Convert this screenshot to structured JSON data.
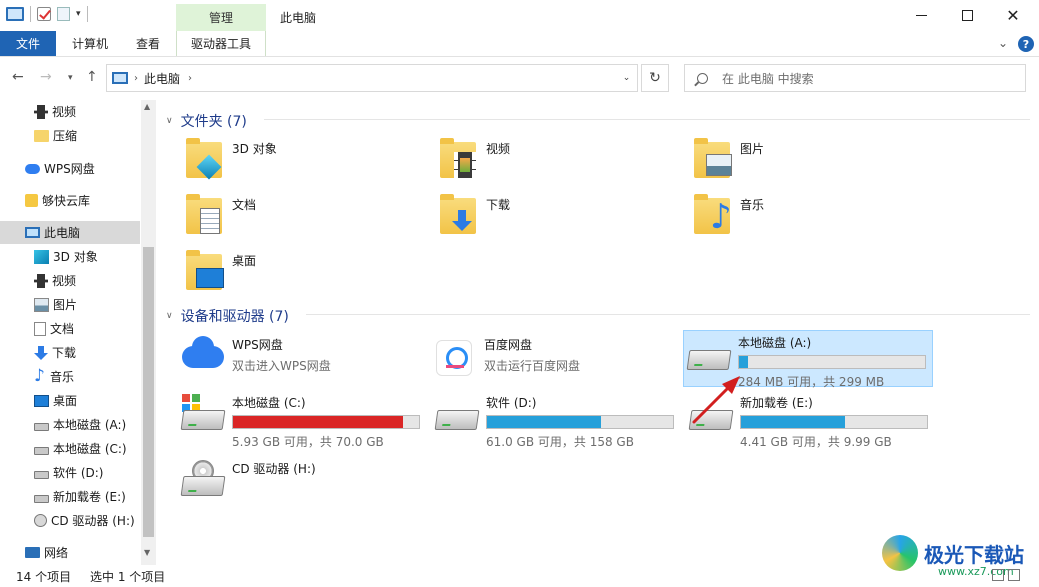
{
  "titlebar": {
    "context_tab": "管理",
    "window_title": "此电脑"
  },
  "ribbon": {
    "tabs": [
      "文件",
      "计算机",
      "查看",
      "驱动器工具"
    ],
    "help": "?"
  },
  "navigation": {
    "back": "←",
    "forward": "→",
    "up": "↑",
    "address_path": "此电脑",
    "refresh": "↻",
    "search_placeholder": "在 此电脑 中搜索"
  },
  "sidebar": {
    "items": [
      {
        "label": "视频",
        "icon": "video-icon"
      },
      {
        "label": "压缩",
        "icon": "folder-icon"
      },
      {
        "label": "WPS网盘",
        "icon": "cloud-icon"
      },
      {
        "label": "够快云库",
        "icon": "cloud-library-icon"
      },
      {
        "label": "此电脑",
        "icon": "computer-icon",
        "selected": true
      },
      {
        "label": "3D 对象",
        "icon": "3d-objects-icon"
      },
      {
        "label": "视频",
        "icon": "video-icon"
      },
      {
        "label": "图片",
        "icon": "picture-icon"
      },
      {
        "label": "文档",
        "icon": "document-icon"
      },
      {
        "label": "下载",
        "icon": "download-icon"
      },
      {
        "label": "音乐",
        "icon": "music-icon"
      },
      {
        "label": "桌面",
        "icon": "desktop-icon"
      },
      {
        "label": "本地磁盘 (A:)",
        "icon": "drive-icon"
      },
      {
        "label": "本地磁盘 (C:)",
        "icon": "drive-icon"
      },
      {
        "label": "软件 (D:)",
        "icon": "drive-icon"
      },
      {
        "label": "新加载卷 (E:)",
        "icon": "drive-icon"
      },
      {
        "label": "CD 驱动器 (H:)",
        "icon": "cd-drive-icon"
      },
      {
        "label": "网络",
        "icon": "network-icon"
      }
    ]
  },
  "main": {
    "folders_header": "文件夹 (7)",
    "folders": [
      "3D 对象",
      "视频",
      "图片",
      "文档",
      "下载",
      "音乐",
      "桌面"
    ],
    "devices_header": "设备和驱动器 (7)",
    "devices": [
      {
        "name": "WPS网盘",
        "sub": "双击进入WPS网盘"
      },
      {
        "name": "百度网盘",
        "sub": "双击运行百度网盘"
      },
      {
        "name": "本地磁盘 (A:)",
        "sub": "284 MB 可用，共 299 MB",
        "used_fraction": 0.05,
        "bar_color": "#26a0da",
        "selected": true
      },
      {
        "name": "本地磁盘 (C:)",
        "sub": "5.93 GB 可用，共 70.0 GB",
        "used_fraction": 0.915,
        "bar_color": "#da2626"
      },
      {
        "name": "软件 (D:)",
        "sub": "61.0 GB 可用，共 158 GB",
        "used_fraction": 0.614,
        "bar_color": "#26a0da"
      },
      {
        "name": "新加载卷 (E:)",
        "sub": "4.41 GB 可用，共 9.99 GB",
        "used_fraction": 0.559,
        "bar_color": "#26a0da"
      },
      {
        "name": "CD 驱动器 (H:)",
        "sub": ""
      }
    ]
  },
  "statusbar": {
    "item_count": "14 个项目",
    "selection": "选中 1 个项目"
  },
  "watermark": {
    "brand": "极光下载站",
    "url": "www.xz7.com"
  }
}
